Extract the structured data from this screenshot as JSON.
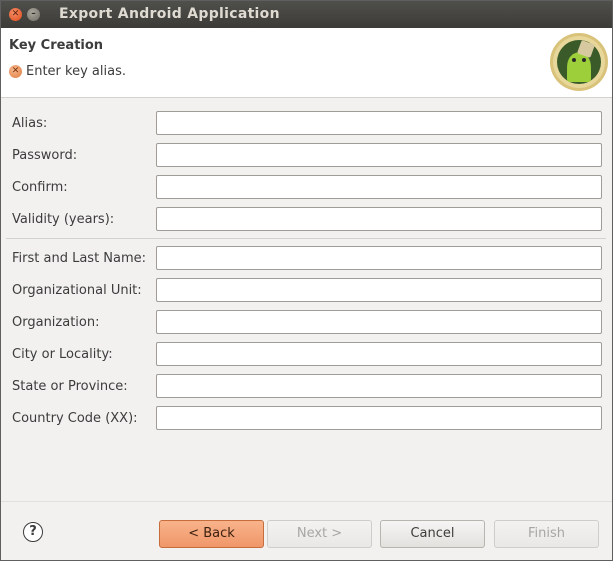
{
  "window": {
    "title": "Export Android Application"
  },
  "banner": {
    "title": "Key Creation",
    "message": "Enter key alias.",
    "message_icon": "error-icon"
  },
  "form": {
    "group1": [
      {
        "label": "Alias:",
        "value": ""
      },
      {
        "label": "Password:",
        "value": ""
      },
      {
        "label": "Confirm:",
        "value": ""
      },
      {
        "label": "Validity (years):",
        "value": ""
      }
    ],
    "group2": [
      {
        "label": "First and Last Name:",
        "value": ""
      },
      {
        "label": "Organizational Unit:",
        "value": ""
      },
      {
        "label": "Organization:",
        "value": ""
      },
      {
        "label": "City or Locality:",
        "value": ""
      },
      {
        "label": "State or Province:",
        "value": ""
      },
      {
        "label": "Country Code (XX):",
        "value": ""
      }
    ]
  },
  "buttons": {
    "back": "< Back",
    "next": "Next >",
    "cancel": "Cancel",
    "finish": "Finish",
    "help": "?"
  },
  "colors": {
    "accent": "#f0966a",
    "titlebar": "#3c3b37",
    "close": "#df4a16"
  }
}
